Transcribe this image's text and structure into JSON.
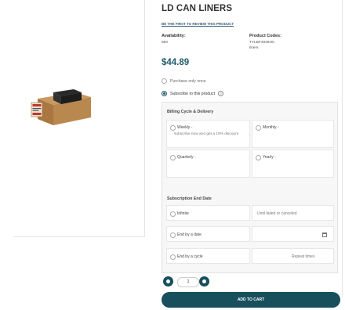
{
  "product": {
    "title": "LD CAN LINERS",
    "review_link": "BE THE FIRST TO REVIEW THIS PRODUCT",
    "availability_label": "Availability:",
    "availability_value": "860",
    "codes_label": "Product Codes:",
    "codes_value_line1": "TYLBF3036HC",
    "codes_value_line2": "liners",
    "price": "$44.89",
    "image_icon": "box-product-image"
  },
  "purchase": {
    "once_label": "Purchase only once",
    "subscribe_label": "Subscribe to this product",
    "selected": "subscribe"
  },
  "billing": {
    "title": "Billing Cycle & Delivery",
    "weekly_label": "Weekly -",
    "weekly_note": "subscribe now and get a 10% discount",
    "monthly_label": "Monthly -",
    "quarterly_label": "Quarterly -",
    "yearly_label": "Yearly -"
  },
  "end_date": {
    "title": "Subscription End Date",
    "infinite_label": "Infinite",
    "infinite_note": "Until failed or canceled",
    "by_date_label": "End by a date",
    "by_cycle_label": "End by a cycle",
    "repeat_label": "Repeat times"
  },
  "cart": {
    "quantity": "1",
    "add_label": "ADD TO CART"
  },
  "colors": {
    "accent": "#174f5c",
    "price": "#1f5c6a"
  }
}
